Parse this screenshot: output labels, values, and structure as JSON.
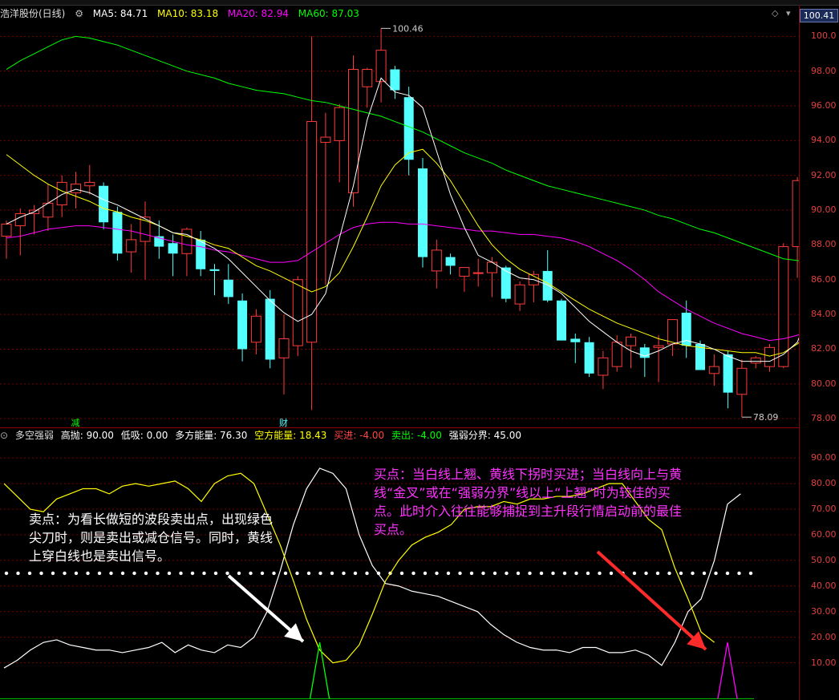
{
  "colors": {
    "up": "#ff3b3b",
    "down": "#54ffff",
    "ma5": "#ffffff",
    "ma10": "#ffff00",
    "ma20": "#ff00ff",
    "ma60": "#00ff00",
    "grid": "#7a0000",
    "axis": "#e04040",
    "buy_note": "#ff33ff",
    "sell_note": "#ffffff"
  },
  "header": {
    "stock_name": "浩洋股份(日线)",
    "ma5": "MA5: 84.71",
    "ma10": "MA10: 83.18",
    "ma20": "MA20: 82.94",
    "ma60": "MA60: 87.03",
    "current_price": "100.41",
    "diamond_icon": "diamond-icon",
    "menu_icon": "chevron-down-icon"
  },
  "indicator_bar": {
    "name": "多空强弱",
    "high_sell": "高抛: 90.00",
    "low_buy": "低吸: 0.00",
    "bull_energy": "多方能量: 76.30",
    "bear_energy": "空方能量: 18.43",
    "buy": "买进: -4.00",
    "sell": "卖出: -4.00",
    "boundary": "强弱分界: 45.00"
  },
  "price_axis": [
    "100.0",
    "98.00",
    "96.00",
    "94.00",
    "92.00",
    "90.00",
    "88.00",
    "86.00",
    "84.00",
    "82.00",
    "80.00",
    "78.00"
  ],
  "indicator_axis": [
    "90.00",
    "80.00",
    "70.00",
    "60.00",
    "50.00",
    "40.00",
    "30.00",
    "20.00",
    "10.00"
  ],
  "markers": {
    "high_label": "100.46",
    "low_label": "78.09",
    "event_reduce": "减",
    "event_finance": "财"
  },
  "notes": {
    "sell_text": "卖点：为看长做短的波段卖出点，出现绿色尖刀时，则是卖出或减仓信号。同时，黄线上穿白线也是卖出信号。",
    "buy_text": "买点：当白线上翘、黄线下拐时买进；当白线向上与黄线“金叉”或在“强弱分界”线以上“上翘”时为较佳的买点。此时介入往往能够捕捉到主升段行情启动前的最佳买点。"
  },
  "chart_data": {
    "type": "candlestick",
    "title": "浩洋股份(日线)",
    "ylim": [
      77.5,
      100.8
    ],
    "candles": [
      {
        "o": 88.5,
        "h": 89.4,
        "l": 87.2,
        "c": 89.2
      },
      {
        "o": 89.1,
        "h": 90.1,
        "l": 87.4,
        "c": 89.8
      },
      {
        "o": 89.8,
        "h": 90.3,
        "l": 88.6,
        "c": 90.0
      },
      {
        "o": 89.6,
        "h": 91.5,
        "l": 88.8,
        "c": 90.4
      },
      {
        "o": 90.3,
        "h": 92.0,
        "l": 89.6,
        "c": 91.6
      },
      {
        "o": 91.0,
        "h": 92.2,
        "l": 90.1,
        "c": 91.5
      },
      {
        "o": 91.4,
        "h": 92.6,
        "l": 90.9,
        "c": 91.6
      },
      {
        "o": 91.4,
        "h": 91.6,
        "l": 88.9,
        "c": 89.3
      },
      {
        "o": 89.9,
        "h": 90.2,
        "l": 87.1,
        "c": 87.5
      },
      {
        "o": 87.6,
        "h": 89.2,
        "l": 86.4,
        "c": 88.3
      },
      {
        "o": 88.2,
        "h": 90.5,
        "l": 86.0,
        "c": 89.6
      },
      {
        "o": 88.5,
        "h": 89.4,
        "l": 87.2,
        "c": 87.9
      },
      {
        "o": 88.1,
        "h": 88.6,
        "l": 86.2,
        "c": 87.5
      },
      {
        "o": 87.5,
        "h": 89.0,
        "l": 86.2,
        "c": 88.9
      },
      {
        "o": 88.3,
        "h": 88.8,
        "l": 86.2,
        "c": 86.6
      },
      {
        "o": 86.6,
        "h": 86.9,
        "l": 85.1,
        "c": 86.5
      },
      {
        "o": 86.0,
        "h": 86.9,
        "l": 84.6,
        "c": 85.0
      },
      {
        "o": 84.8,
        "h": 85.2,
        "l": 81.3,
        "c": 82.0
      },
      {
        "o": 82.4,
        "h": 84.3,
        "l": 81.7,
        "c": 83.9
      },
      {
        "o": 84.9,
        "h": 85.4,
        "l": 80.9,
        "c": 81.4
      },
      {
        "o": 81.5,
        "h": 84.0,
        "l": 79.4,
        "c": 82.6
      },
      {
        "o": 82.2,
        "h": 86.2,
        "l": 81.6,
        "c": 86.0
      },
      {
        "o": 82.4,
        "h": 100.0,
        "l": 78.5,
        "c": 95.1
      },
      {
        "o": 93.9,
        "h": 95.6,
        "l": 85.7,
        "c": 94.2
      },
      {
        "o": 94.0,
        "h": 96.1,
        "l": 91.6,
        "c": 95.9
      },
      {
        "o": 91.0,
        "h": 98.9,
        "l": 90.2,
        "c": 98.1
      },
      {
        "o": 97.1,
        "h": 98.2,
        "l": 95.9,
        "c": 98.1
      },
      {
        "o": 97.4,
        "h": 100.46,
        "l": 96.2,
        "c": 99.2
      },
      {
        "o": 98.1,
        "h": 98.3,
        "l": 96.4,
        "c": 96.9
      },
      {
        "o": 96.5,
        "h": 97.1,
        "l": 92.0,
        "c": 92.9
      },
      {
        "o": 92.4,
        "h": 93.0,
        "l": 86.7,
        "c": 87.3
      },
      {
        "o": 86.5,
        "h": 88.3,
        "l": 85.5,
        "c": 87.7
      },
      {
        "o": 87.3,
        "h": 87.5,
        "l": 86.3,
        "c": 86.8
      },
      {
        "o": 86.2,
        "h": 86.6,
        "l": 85.3,
        "c": 86.7
      },
      {
        "o": 86.4,
        "h": 87.2,
        "l": 85.6,
        "c": 86.4
      },
      {
        "o": 86.4,
        "h": 87.3,
        "l": 85.0,
        "c": 87.0
      },
      {
        "o": 86.7,
        "h": 86.8,
        "l": 84.7,
        "c": 84.9
      },
      {
        "o": 84.6,
        "h": 85.9,
        "l": 84.2,
        "c": 85.7
      },
      {
        "o": 85.7,
        "h": 86.5,
        "l": 84.7,
        "c": 86.3
      },
      {
        "o": 86.5,
        "h": 87.7,
        "l": 84.7,
        "c": 84.8
      },
      {
        "o": 84.8,
        "h": 84.9,
        "l": 82.5,
        "c": 82.5
      },
      {
        "o": 82.6,
        "h": 82.9,
        "l": 81.2,
        "c": 82.4
      },
      {
        "o": 82.4,
        "h": 82.7,
        "l": 80.4,
        "c": 80.6
      },
      {
        "o": 80.5,
        "h": 81.9,
        "l": 79.7,
        "c": 81.5
      },
      {
        "o": 81.0,
        "h": 82.8,
        "l": 80.7,
        "c": 82.4
      },
      {
        "o": 82.2,
        "h": 82.9,
        "l": 80.9,
        "c": 82.7
      },
      {
        "o": 82.1,
        "h": 82.3,
        "l": 80.4,
        "c": 81.5
      },
      {
        "o": 82.1,
        "h": 82.8,
        "l": 80.1,
        "c": 82.2
      },
      {
        "o": 82.3,
        "h": 83.4,
        "l": 81.6,
        "c": 83.7
      },
      {
        "o": 84.1,
        "h": 84.8,
        "l": 81.5,
        "c": 82.2
      },
      {
        "o": 82.3,
        "h": 82.5,
        "l": 80.8,
        "c": 80.8
      },
      {
        "o": 80.6,
        "h": 81.7,
        "l": 79.9,
        "c": 81.0
      },
      {
        "o": 81.7,
        "h": 81.9,
        "l": 78.6,
        "c": 79.5
      },
      {
        "o": 79.4,
        "h": 81.4,
        "l": 78.09,
        "c": 80.9
      },
      {
        "o": 81.2,
        "h": 81.6,
        "l": 80.9,
        "c": 81.5
      },
      {
        "o": 81.0,
        "h": 82.3,
        "l": 80.7,
        "c": 82.1
      },
      {
        "o": 81.0,
        "h": 88.1,
        "l": 80.9,
        "c": 87.9
      },
      {
        "o": 87.9,
        "h": 91.9,
        "l": 86.1,
        "c": 91.7
      }
    ],
    "ma5": [
      89.2,
      89.6,
      89.9,
      90.4,
      90.9,
      91.2,
      91.0,
      90.6,
      90.3,
      89.9,
      89.5,
      89.1,
      88.7,
      88.6,
      88.2,
      87.8,
      87.2,
      86.4,
      85.6,
      84.8,
      84.1,
      83.6,
      84.0,
      85.2,
      88.4,
      91.4,
      95.2,
      97.6,
      96.8,
      96.6,
      95.9,
      93.4,
      90.9,
      89.0,
      87.4,
      87.0,
      86.5,
      86.1,
      86.0,
      85.7,
      85.2,
      84.4,
      83.6,
      83.0,
      82.4,
      81.9,
      81.6,
      81.9,
      82.3,
      82.5,
      82.3,
      82.0,
      81.6,
      81.3,
      81.3,
      81.3,
      81.7,
      82.4,
      84.5
    ],
    "ma10": [
      93.2,
      92.6,
      92.0,
      91.5,
      91.1,
      90.8,
      90.5,
      90.1,
      89.9,
      89.6,
      89.4,
      89.1,
      88.7,
      88.5,
      88.3,
      88.0,
      87.8,
      87.3,
      86.8,
      86.5,
      86.1,
      85.7,
      85.3,
      85.6,
      86.4,
      87.9,
      89.6,
      91.4,
      92.6,
      93.3,
      93.5,
      92.7,
      91.7,
      90.4,
      89.1,
      88.0,
      87.2,
      86.6,
      86.2,
      85.8,
      85.3,
      84.8,
      84.3,
      83.9,
      83.5,
      83.2,
      82.9,
      82.6,
      82.4,
      82.2,
      82.1,
      82.0,
      81.9,
      81.8,
      81.8,
      81.6,
      81.8,
      82.3,
      83.0
    ],
    "ma20": [
      88.4,
      88.5,
      88.7,
      88.9,
      89.0,
      89.1,
      89.1,
      89.0,
      88.9,
      88.8,
      88.6,
      88.4,
      88.2,
      88.0,
      87.9,
      87.7,
      87.6,
      87.4,
      87.2,
      87.0,
      87.0,
      87.1,
      87.6,
      88.1,
      88.6,
      89.0,
      89.2,
      89.3,
      89.3,
      89.2,
      89.2,
      89.1,
      89.0,
      88.9,
      88.8,
      88.8,
      88.7,
      88.6,
      88.6,
      88.5,
      88.4,
      88.2,
      87.9,
      87.5,
      87.1,
      86.6,
      86.0,
      85.3,
      84.8,
      84.3,
      83.9,
      83.5,
      83.2,
      82.9,
      82.7,
      82.5,
      82.6,
      82.8,
      83.2
    ],
    "ma60": [
      98.1,
      98.6,
      99.0,
      99.4,
      99.8,
      100.0,
      99.9,
      99.7,
      99.5,
      99.2,
      98.9,
      98.6,
      98.3,
      98.0,
      97.8,
      97.6,
      97.3,
      97.1,
      96.9,
      96.8,
      96.7,
      96.5,
      96.3,
      96.2,
      96.0,
      95.8,
      95.6,
      95.4,
      95.1,
      94.8,
      94.5,
      94.1,
      93.7,
      93.3,
      93.0,
      92.7,
      92.3,
      92.0,
      91.7,
      91.4,
      91.2,
      91.0,
      90.8,
      90.6,
      90.4,
      90.2,
      90.0,
      89.7,
      89.5,
      89.2,
      88.9,
      88.7,
      88.4,
      88.1,
      87.8,
      87.5,
      87.2,
      87.1,
      87.0
    ],
    "indicator": {
      "ylim": [
        -4.5,
        96
      ],
      "boundary": 45,
      "white": [
        8,
        11,
        15,
        18,
        19,
        17,
        16,
        15,
        15,
        14,
        15,
        16,
        18,
        14,
        17,
        15,
        14,
        17,
        16,
        20,
        30,
        46,
        64,
        78,
        86,
        84,
        78,
        60,
        48,
        41,
        40,
        38,
        37,
        36,
        34,
        32,
        30,
        25,
        21,
        18,
        16,
        15,
        15,
        14,
        16,
        16,
        14,
        14,
        15,
        13,
        9,
        18,
        30,
        35,
        50,
        72,
        76
      ],
      "yellow": [
        80,
        75,
        70,
        69,
        74,
        76,
        78,
        78,
        76,
        79,
        80,
        79,
        80,
        81,
        78,
        73,
        80,
        83,
        84,
        80,
        68,
        56,
        42,
        27,
        15,
        10,
        11,
        17,
        29,
        42,
        50,
        56,
        59,
        61,
        64,
        70,
        71,
        71,
        73,
        72,
        74,
        74,
        75,
        75,
        76,
        78,
        80,
        80,
        73,
        66,
        62,
        47,
        35,
        22,
        18
      ],
      "green_spike": {
        "index": 24,
        "peak": 18
      },
      "purple_spike": {
        "index": 55,
        "peak": 18
      }
    }
  }
}
